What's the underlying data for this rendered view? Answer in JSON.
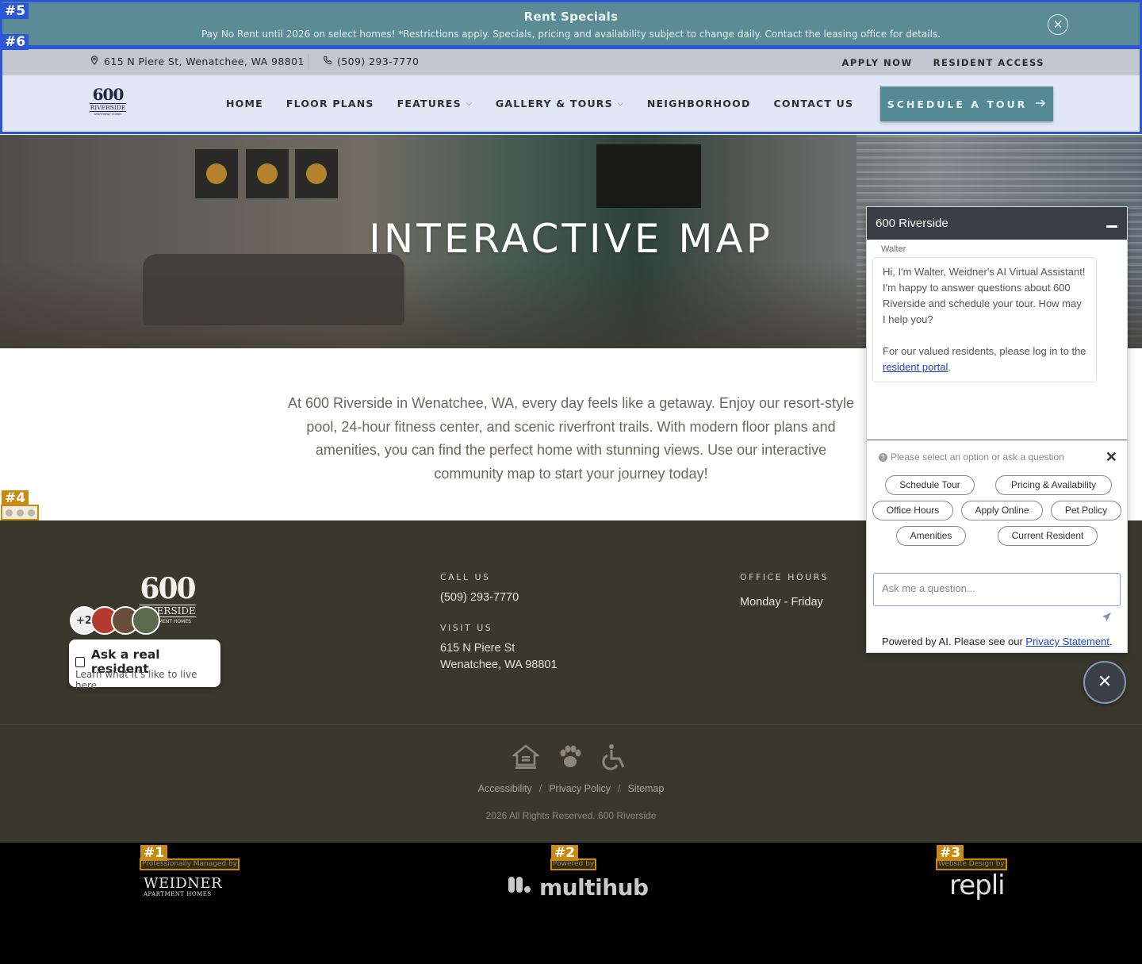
{
  "markers": [
    "#1",
    "#2",
    "#3",
    "#4",
    "#5",
    "#6"
  ],
  "promo": {
    "title": "Rent Specials",
    "text": "Pay No Rent until 2026 on select homes! *Restrictions apply. Specials, pricing and availability subject to change daily. Contact the leasing office for details.",
    "close_icon": "close-icon"
  },
  "topbar": {
    "address": "615 N Piere St, Wenatchee, WA 98801",
    "phone": "(509) 293-7770",
    "apply": "APPLY NOW",
    "resident_access": "RESIDENT ACCESS"
  },
  "logo": {
    "number": "600",
    "name": "RIVERSIDE",
    "sub": "APARTMENT HOMES"
  },
  "nav": {
    "items": [
      "HOME",
      "FLOOR PLANS",
      "FEATURES",
      "GALLERY & TOURS",
      "NEIGHBORHOOD",
      "CONTACT US"
    ],
    "cta": "SCHEDULE A TOUR"
  },
  "hero": {
    "title": "INTERACTIVE MAP"
  },
  "intro": "At 600 Riverside in Wenatchee, WA, every day feels like a getaway. Enjoy our resort-style pool, 24-hour fitness center, and scenic riverfront trails. With modern floor plans and amenities, you can find the perfect home with stunning views. Use our interactive community map to start your journey today!",
  "footer": {
    "avatar_count": "+2",
    "ask_title": "Ask a real resident",
    "ask_sub": "Learn what it's like to live here",
    "call_label": "CALL US",
    "call_value": "(509) 293-7770",
    "visit_label": "VISIT US",
    "visit_line1": "615 N Piere St",
    "visit_line2": "Wenatchee, WA 98801",
    "hours_label": "OFFICE HOURS",
    "hours_value": "Monday - Friday",
    "icons": [
      "equal-housing-icon",
      "paw-icon",
      "accessibility-icon"
    ],
    "links": [
      "Accessibility",
      "Privacy Policy",
      "Sitemap"
    ],
    "separator": "/",
    "copyright": "2026 All Rights Reserved. 600 Riverside"
  },
  "partners": {
    "managed_label": "Professionally Managed by",
    "managed_name": "WEIDNER",
    "managed_sub": "APARTMENT HOMES",
    "powered_label": "Powered by",
    "powered_name": "multihub",
    "design_label": "Website Design by",
    "design_name": "repli"
  },
  "chat": {
    "title": "600 Riverside",
    "sender": "Walter",
    "message_p1": "Hi, I'm Walter, Weidner's AI Virtual Assistant! I'm happy to answer questions about 600 Riverside and schedule your tour. How may I help you?",
    "message_p2_prefix": "For our valued residents, please log in to the",
    "message_p2_link": "resident portal",
    "message_p2_suffix": ".",
    "prompt": "Please select an option or ask a question",
    "options": [
      "Schedule Tour",
      "Pricing & Availability",
      "Office Hours",
      "Apply Online",
      "Pet Policy",
      "Amenities",
      "Current Resident"
    ],
    "input_placeholder": "Ask me a question...",
    "powered_prefix": "Powered by AI. Please see our",
    "powered_link": "Privacy Statement",
    "powered_suffix": "."
  }
}
